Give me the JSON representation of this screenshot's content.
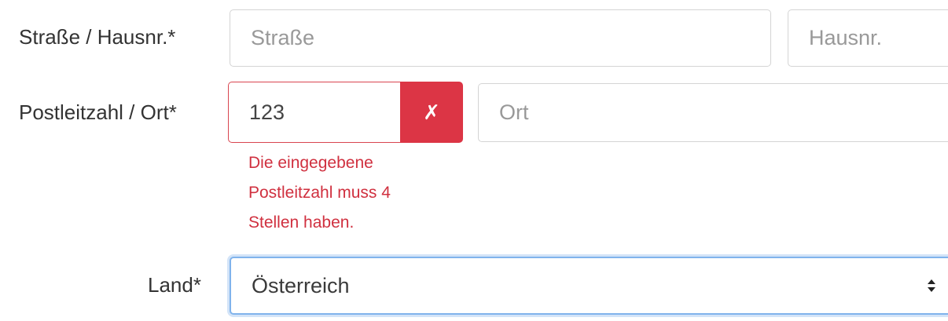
{
  "fields": {
    "street_label": "Straße / Hausnr.*",
    "street_placeholder": "Straße",
    "house_number_placeholder": "Hausnr.",
    "zip_city_label": "Postleitzahl / Ort*",
    "zip_value": "123",
    "zip_error_icon": "✗",
    "city_placeholder": "Ort",
    "zip_error_message_lines": [
      "Die eingegebene",
      "Postleitzahl muss 4",
      "Stellen haben."
    ],
    "country_label": "Land*",
    "country_value": "Österreich"
  },
  "colors": {
    "error": "#dc3545",
    "focus": "#80b3ec"
  },
  "icons": {
    "error": "cross-icon",
    "select": "sort-arrows-icon"
  }
}
